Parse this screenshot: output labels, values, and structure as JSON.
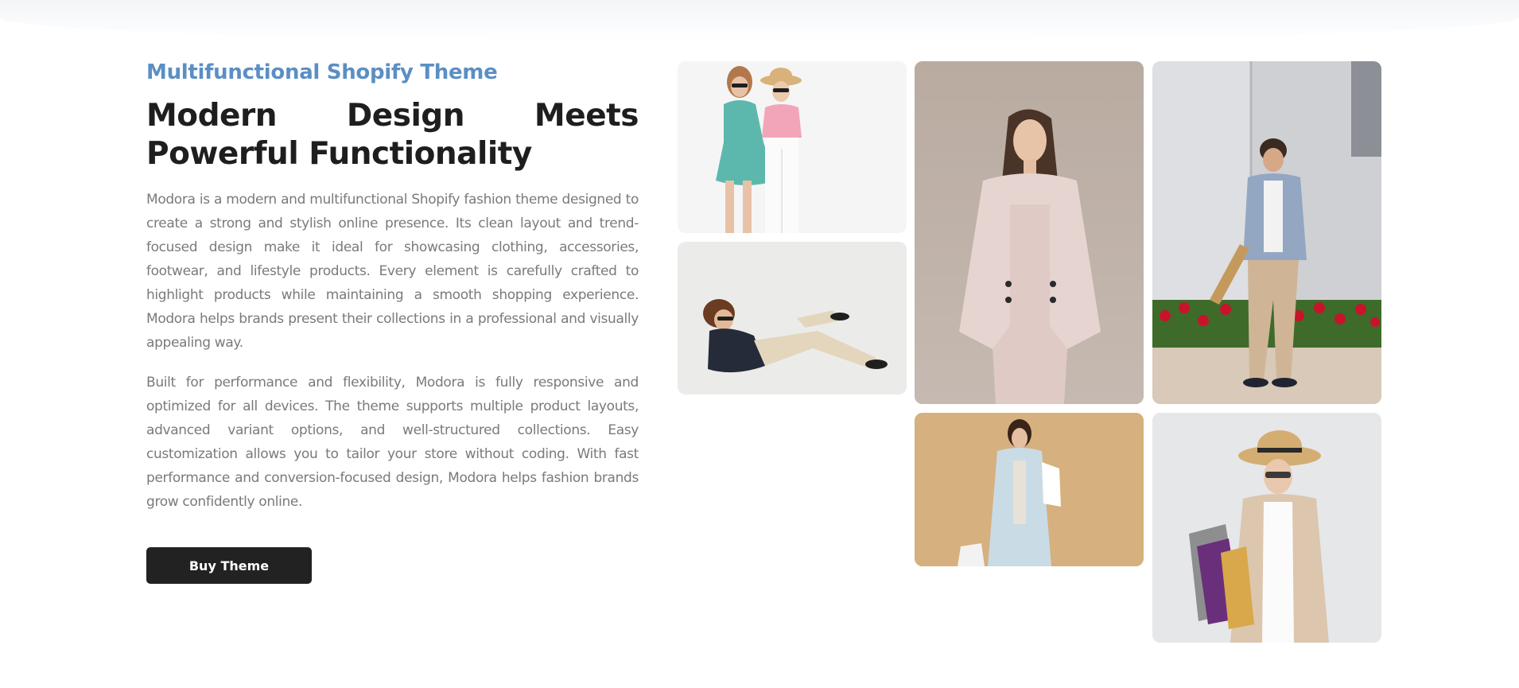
{
  "section": {
    "eyebrow": "Multifunctional Shopify Theme",
    "headline": "Modern Design Meets Powerful Functionality",
    "paragraphs": [
      "Modora is a modern and multifunctional Shopify fashion theme designed to create a strong and stylish online presence. Its clean layout and trend-focused design make it ideal for showcasing clothing, accessories, footwear, and lifestyle products. Every element is carefully crafted to highlight products while maintaining a smooth shopping experience. Modora helps brands present their collections in a professional and visually appealing way.",
      "Built for performance and flexibility, Modora is fully responsive and optimized for all devices. The theme supports multiple product layouts, advanced variant options, and well-structured collections. Easy customization allows you to tailor your store without coding. With fast performance and conversion-focused design, Modora helps fashion brands grow confidently online."
    ],
    "cta_label": "Buy Theme"
  },
  "gallery": {
    "images": [
      "two-women-sunglasses-photo",
      "man-reclining-sunglasses-photo",
      "woman-pink-blazer-photo",
      "man-denim-jacket-skateboard-photo",
      "woman-light-blue-coat-photo",
      "woman-straw-hat-shopping-bags-photo"
    ]
  },
  "colors": {
    "accent": "#5b8fc4",
    "heading": "#1e1e1e",
    "body_text": "#7a7a7a",
    "button_bg": "#222222",
    "button_text": "#ffffff"
  }
}
